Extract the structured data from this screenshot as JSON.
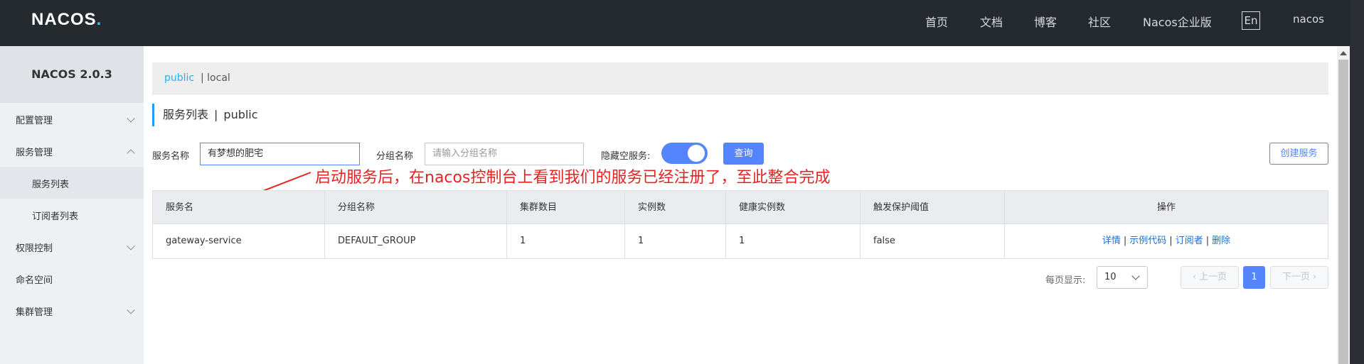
{
  "brand": {
    "logo_text": "NACOS",
    "logo_dot": "."
  },
  "nav": {
    "items": [
      "首页",
      "文档",
      "博客",
      "社区",
      "Nacos企业版"
    ],
    "lang": "En",
    "user": "nacos"
  },
  "sidebar": {
    "title": "NACOS 2.0.3",
    "items": [
      {
        "label": "配置管理"
      },
      {
        "label": "服务管理"
      },
      {
        "label": "服务列表"
      },
      {
        "label": "订阅者列表"
      },
      {
        "label": "权限控制"
      },
      {
        "label": "命名空间"
      },
      {
        "label": "集群管理"
      }
    ]
  },
  "namespace": {
    "active": "public",
    "other": "| local"
  },
  "page": {
    "title": "服务列表",
    "separator": "|",
    "namespace": "public"
  },
  "filters": {
    "service_name_label": "服务名称",
    "service_name_value": "有梦想的肥宅",
    "group_label": "分组名称",
    "group_placeholder": "请输入分组名称",
    "hide_empty_label": "隐藏空服务:",
    "query_button": "查询",
    "create_button": "创建服务"
  },
  "annotation": "启动服务后，在nacos控制台上看到我们的服务已经注册了，至此整合完成",
  "table": {
    "headers": [
      "服务名",
      "分组名称",
      "集群数目",
      "实例数",
      "健康实例数",
      "触发保护阈值",
      "操作"
    ],
    "rows": [
      {
        "service": "gateway-service",
        "group": "DEFAULT_GROUP",
        "clusters": "1",
        "instances": "1",
        "healthy": "1",
        "threshold": "false"
      }
    ],
    "actions": [
      "详情",
      "示例代码",
      "订阅者",
      "删除"
    ]
  },
  "pagination": {
    "per_page_label": "每页显示:",
    "per_page_value": "10",
    "prev": "上一页",
    "current": "1",
    "next": "下一页"
  },
  "colors": {
    "accent": "#5584ff",
    "annotation": "#e52323",
    "topbar": "#252a2f"
  }
}
